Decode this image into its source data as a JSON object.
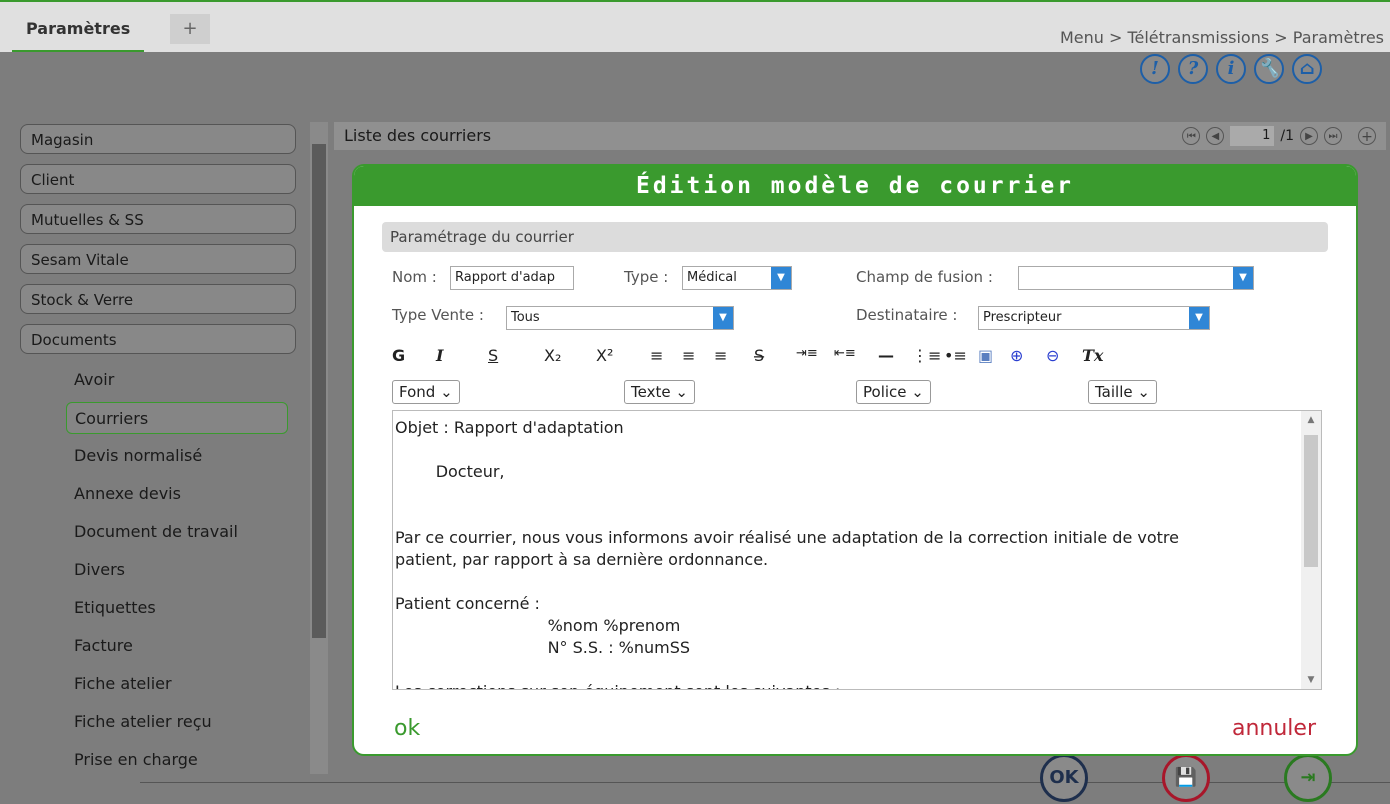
{
  "tabs": {
    "active": "Paramètres",
    "add": "+"
  },
  "breadcrumb": "Menu > Télétransmissions > Paramètres",
  "header_icons": [
    "!",
    "?",
    "i",
    "🔧",
    "⌂"
  ],
  "sidebar": {
    "items": [
      "Magasin",
      "Client",
      "Mutuelles & SS",
      "Sesam Vitale",
      "Stock & Verre",
      "Documents"
    ],
    "sub_items": [
      "Avoir",
      "Courriers",
      "Devis normalisé",
      "Annexe devis",
      "Document de travail",
      "Divers",
      "Etiquettes",
      "Facture",
      "Fiche atelier",
      "Fiche atelier reçu",
      "Prise en charge"
    ],
    "active_sub": "Courriers"
  },
  "list": {
    "title": "Liste des courriers",
    "page_current": "1",
    "page_total": "/1"
  },
  "bottom_actions": {
    "ok": "OK",
    "save": "💾",
    "exit": "⇥"
  },
  "modal": {
    "title": "Édition modèle de courrier",
    "section_title": "Paramétrage du courrier",
    "nom_label": "Nom :",
    "nom_value": "Rapport d'adap",
    "type_label": "Type :",
    "type_value": "Médical",
    "champ_label": "Champ de fusion :",
    "champ_value": "",
    "type_vente_label": "Type Vente :",
    "type_vente_value": "Tous",
    "destinataire_label": "Destinataire :",
    "destinataire_value": "Prescripteur",
    "toolbar": [
      "G",
      "I",
      "S",
      "X₂",
      "X²",
      "≡",
      "≡",
      "≡",
      "S̶",
      "⇥≡",
      "⇤≡",
      "—",
      "⋮≡",
      "•≡",
      "▣",
      "⊕",
      "⊖",
      "Tx"
    ],
    "dropdowns": {
      "fond": "Fond",
      "texte": "Texte",
      "police": "Police",
      "taille": "Taille"
    },
    "editor_lines": [
      "Objet : Rapport d'adaptation",
      "",
      "        Docteur,",
      "",
      "",
      "Par ce courrier, nous vous informons avoir réalisé une adaptation de la correction initiale de votre",
      "patient, par rapport à sa dernière ordonnance.",
      "",
      "Patient concerné :",
      "                              %nom %prenom",
      "                              N° S.S. : %numSS",
      "",
      "Les corrections sur son équipement sont les suivantes :"
    ],
    "ok_label": "ok",
    "cancel_label": "annuler"
  },
  "colors": {
    "accent": "#3a9a2e",
    "cancel": "#c0283a",
    "select_blue": "#2f86d6",
    "icon_blue": "#1d5fa8"
  }
}
